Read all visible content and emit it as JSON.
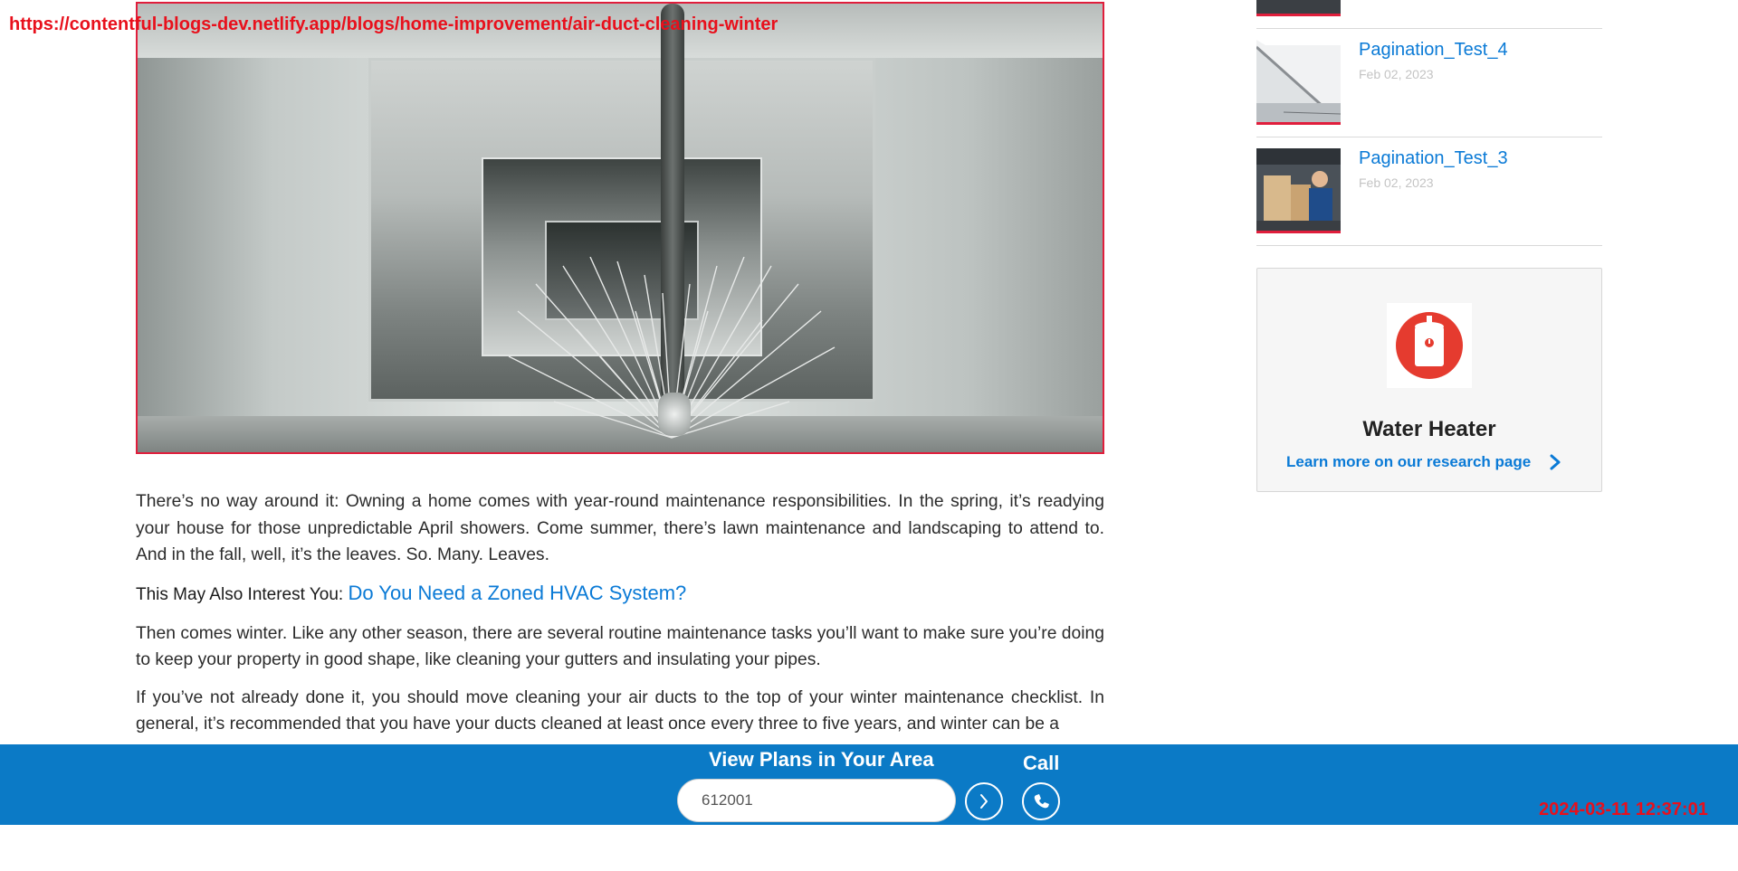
{
  "overlay": {
    "url": "https://contentful-blogs-dev.netlify.app/blogs/home-improvement/air-duct-cleaning-winter",
    "timestamp": "2024-03-11 12:37:01"
  },
  "hero": {
    "image_icon": "air-duct-brush-image"
  },
  "article": {
    "paragraphs": [
      "There’s no way around it: Owning a home comes with year-round maintenance responsibilities. In the spring, it’s readying your house for those unpredictable April showers. Come summer, there’s lawn maintenance and landscaping to attend to. And in the fall, well, it’s the leaves. So. Many. Leaves.",
      "Then comes winter. Like any other season, there are several routine maintenance tasks you’ll want to make sure you’re doing to keep your property in good shape, like cleaning your gutters and insulating your pipes.",
      "If you’ve not already done it, you should move cleaning your air ducts to the top of your winter maintenance checklist. In general, it’s recommended that you have your ducts cleaned at least once every three to five years, and winter can be a"
    ],
    "interest": {
      "label": "This May Also Interest You:",
      "link_text": "Do You Need a Zoned HVAC System?"
    }
  },
  "sidebar": {
    "posts": [
      {
        "title": "Pagination_Test_4",
        "date": "Feb 02, 2023",
        "thumb_icon": "house-roof-thumbnail"
      },
      {
        "title": "Pagination_Test_3",
        "date": "Feb 02, 2023",
        "thumb_icon": "technician-thumbnail"
      }
    ],
    "promo": {
      "icon": "water-heater-icon",
      "title": "Water Heater",
      "link_text": "Learn more on our research page",
      "accent": "#e53b2f"
    }
  },
  "cta_bar": {
    "heading": "View Plans in Your Area",
    "zip_value": "612001",
    "call_label": "Call",
    "background": "#0b7ac6"
  }
}
